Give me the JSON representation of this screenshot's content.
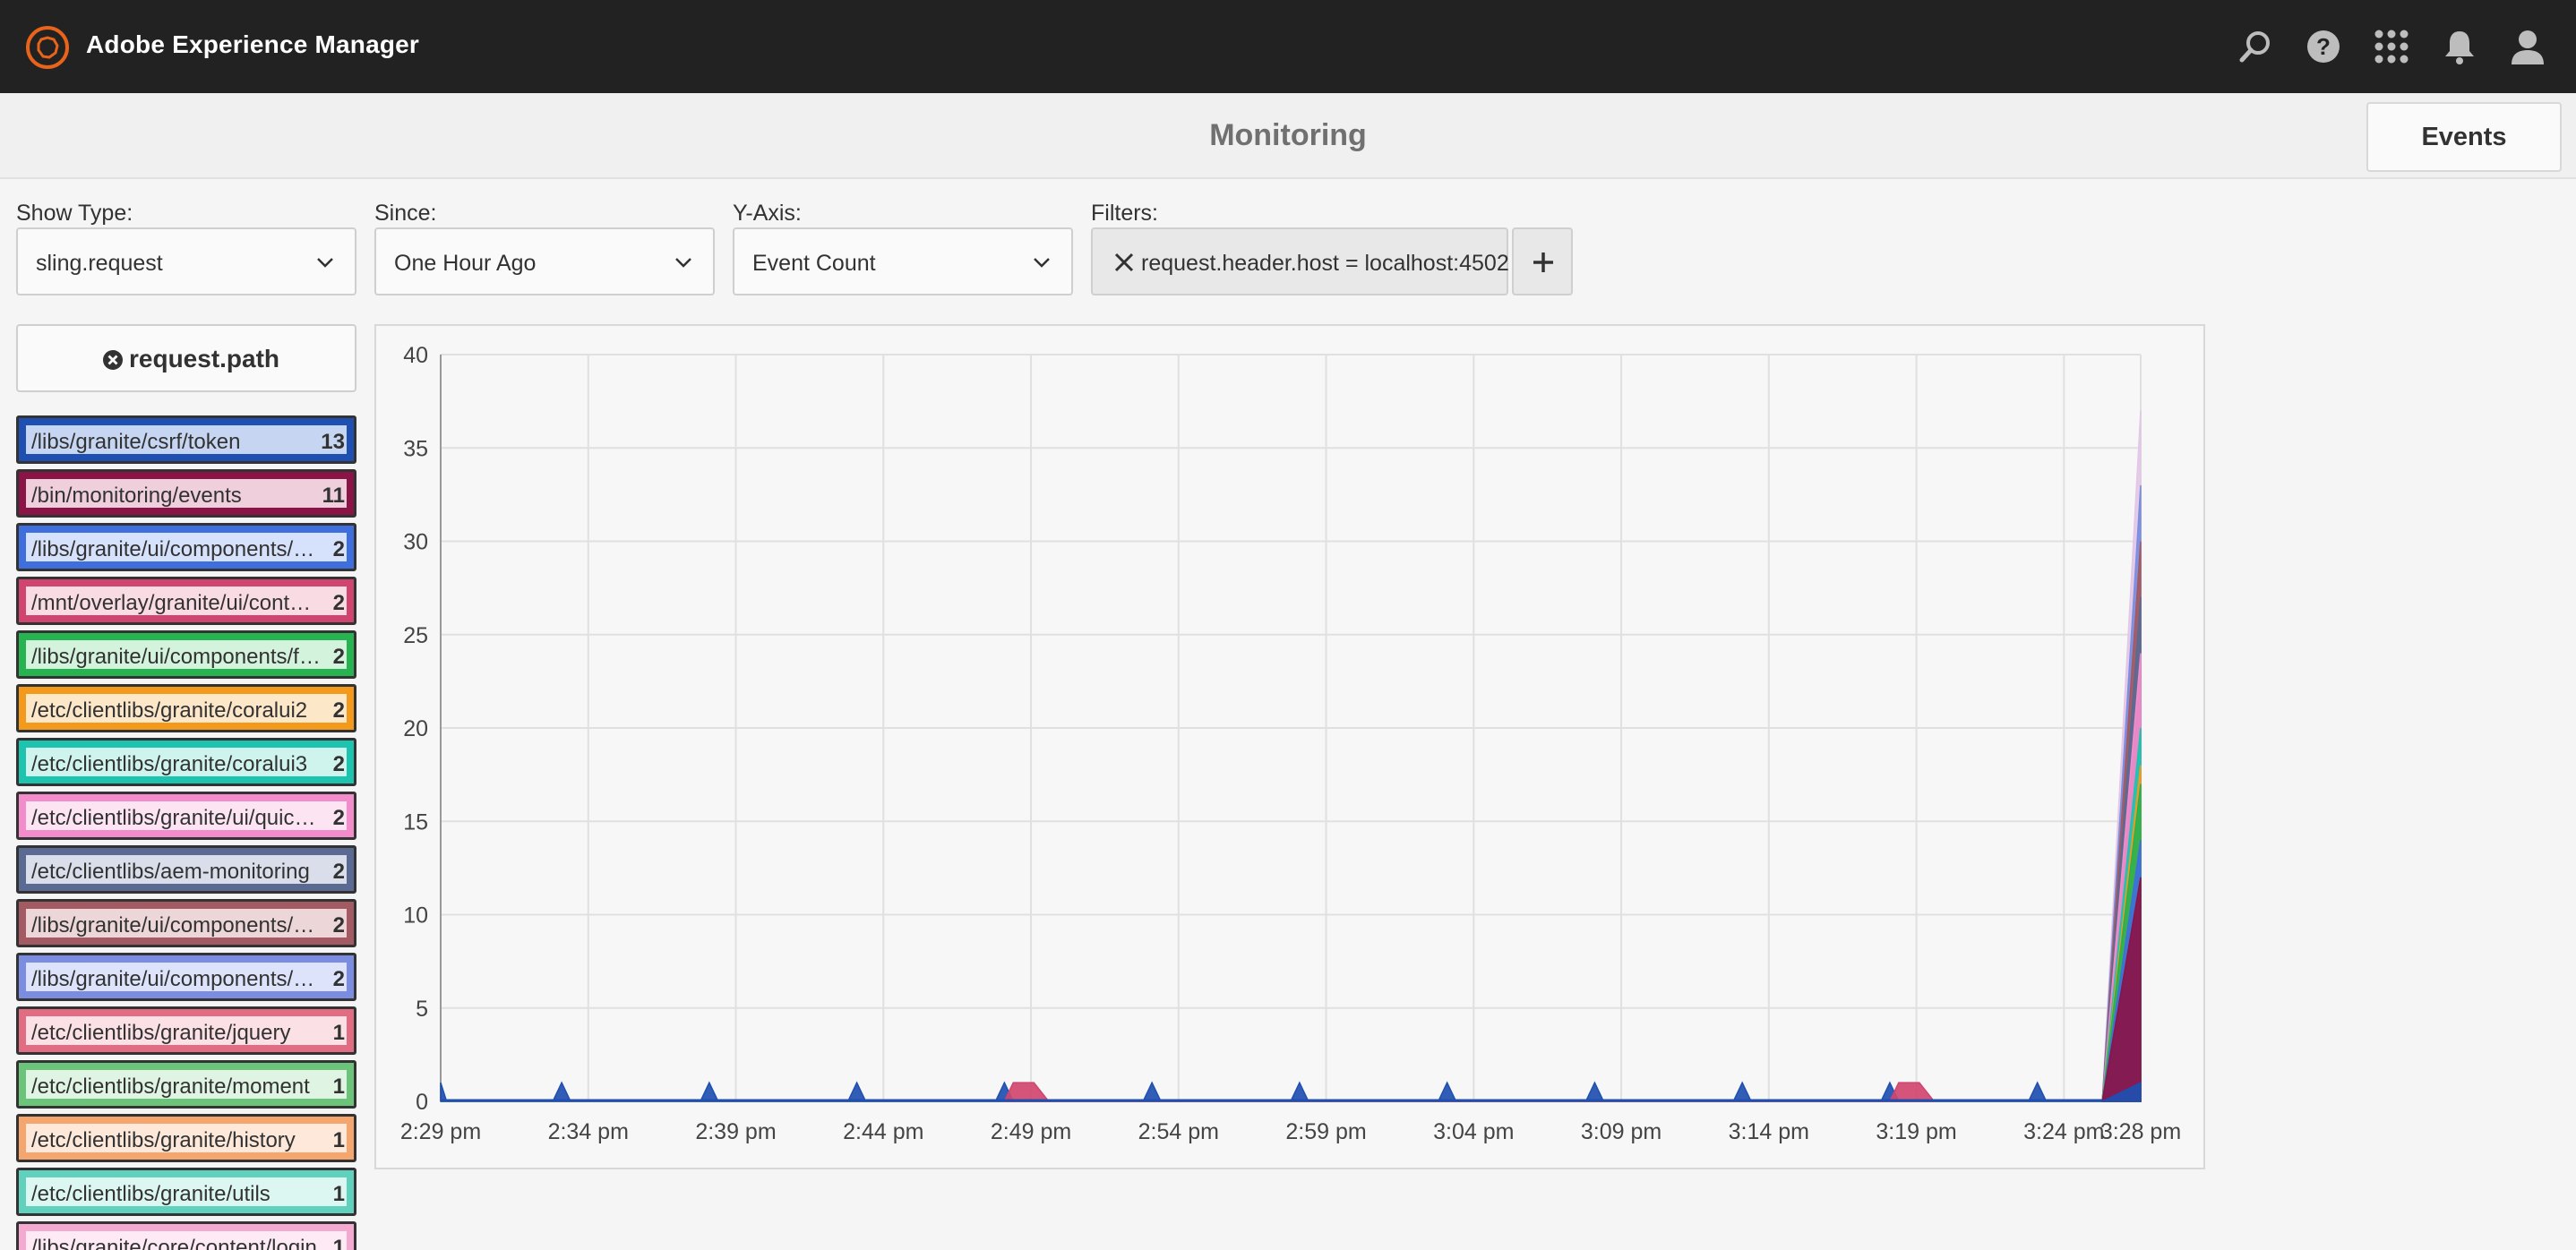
{
  "header": {
    "app_title": "Adobe Experience Manager",
    "icons": [
      "search-icon",
      "help-icon",
      "solutions-icon",
      "notifications-icon",
      "user-icon"
    ]
  },
  "subheader": {
    "title": "Monitoring",
    "events_label": "Events"
  },
  "controls": {
    "show_type": {
      "label": "Show Type:",
      "value": "sling.request"
    },
    "since": {
      "label": "Since:",
      "value": "One Hour Ago"
    },
    "y_axis": {
      "label": "Y-Axis:",
      "value": "Event Count"
    },
    "filters": {
      "label": "Filters:",
      "value": "request.header.host = localhost:4502"
    }
  },
  "group_by": {
    "label": "request.path"
  },
  "legend": [
    {
      "path": "/libs/granite/csrf/token",
      "count": "13",
      "border": "#1f4fb0",
      "fill": "#c6d6f2"
    },
    {
      "path": "/bin/monitoring/events",
      "count": "11",
      "border": "#8a1446",
      "fill": "#efcfdc"
    },
    {
      "path": "/libs/granite/ui/components/coral/foundation",
      "count": "2",
      "border": "#3f6fdc",
      "fill": "#d6e2fb"
    },
    {
      "path": "/mnt/overlay/granite/ui/content/shell",
      "count": "2",
      "border": "#d0456f",
      "fill": "#f9dbe4"
    },
    {
      "path": "/libs/granite/ui/components/foundation",
      "count": "2",
      "border": "#27b34f",
      "fill": "#d3f3dc"
    },
    {
      "path": "/etc/clientlibs/granite/coralui2",
      "count": "2",
      "border": "#f39a1d",
      "fill": "#fde7c9"
    },
    {
      "path": "/etc/clientlibs/granite/coralui3",
      "count": "2",
      "border": "#1cc4b0",
      "fill": "#cff4ee"
    },
    {
      "path": "/etc/clientlibs/granite/ui/quickstart",
      "count": "2",
      "border": "#f28ccb",
      "fill": "#fde4f2"
    },
    {
      "path": "/etc/clientlibs/aem-monitoring",
      "count": "2",
      "border": "#5a6a92",
      "fill": "#d9deea"
    },
    {
      "path": "/libs/granite/ui/components/shell",
      "count": "2",
      "border": "#a45a62",
      "fill": "#ecd6d8"
    },
    {
      "path": "/libs/granite/ui/components/shell/header",
      "count": "2",
      "border": "#7a8de0",
      "fill": "#dde3fa"
    },
    {
      "path": "/etc/clientlibs/granite/jquery",
      "count": "1",
      "border": "#e26d83",
      "fill": "#fbe0e6"
    },
    {
      "path": "/etc/clientlibs/granite/moment",
      "count": "1",
      "border": "#6cc47a",
      "fill": "#e0f4e3"
    },
    {
      "path": "/etc/clientlibs/granite/history",
      "count": "1",
      "border": "#f5a56e",
      "fill": "#fde8da"
    },
    {
      "path": "/etc/clientlibs/granite/utils",
      "count": "1",
      "border": "#5fd1bd",
      "fill": "#dcf6f1"
    },
    {
      "path": "/libs/granite/core/content/login",
      "count": "1",
      "border": "#f3a9d0",
      "fill": "#fdeaf4"
    }
  ],
  "chart_data": {
    "type": "area",
    "x_ticks": [
      "2:29 pm",
      "2:34 pm",
      "2:39 pm",
      "2:44 pm",
      "2:49 pm",
      "2:54 pm",
      "2:59 pm",
      "3:04 pm",
      "3:09 pm",
      "3:14 pm",
      "3:19 pm",
      "3:24 pm",
      "3:28 pm"
    ],
    "ylim": [
      0,
      40
    ],
    "y_ticks": [
      0,
      5,
      10,
      15,
      20,
      25,
      30,
      35,
      40
    ],
    "grid": true,
    "series": [
      {
        "color": "#1f4fb0",
        "points": [
          [
            0,
            1
          ],
          [
            0.2,
            0
          ],
          [
            3.8,
            0
          ],
          [
            4.1,
            1
          ],
          [
            4.4,
            0
          ],
          [
            8.8,
            0
          ],
          [
            9.1,
            1
          ],
          [
            9.4,
            0
          ],
          [
            13.8,
            0
          ],
          [
            14.1,
            1
          ],
          [
            14.4,
            0
          ],
          [
            18.8,
            0
          ],
          [
            19.1,
            1
          ],
          [
            19.4,
            0
          ],
          [
            23.8,
            0
          ],
          [
            24.1,
            1
          ],
          [
            24.4,
            0
          ],
          [
            28.8,
            0
          ],
          [
            29.1,
            1
          ],
          [
            29.4,
            0
          ],
          [
            33.8,
            0
          ],
          [
            34.1,
            1
          ],
          [
            34.4,
            0
          ],
          [
            38.8,
            0
          ],
          [
            39.1,
            1
          ],
          [
            39.4,
            0
          ],
          [
            43.8,
            0
          ],
          [
            44.1,
            1
          ],
          [
            44.4,
            0
          ],
          [
            48.8,
            0
          ],
          [
            49.1,
            1
          ],
          [
            49.4,
            0
          ],
          [
            53.8,
            0
          ],
          [
            54.1,
            1
          ],
          [
            54.4,
            0
          ],
          [
            56.3,
            0
          ],
          [
            57.6,
            1
          ]
        ]
      },
      {
        "color": "#d0456f",
        "points": [
          [
            19.1,
            0
          ],
          [
            19.4,
            1
          ],
          [
            20.1,
            1
          ],
          [
            20.6,
            0
          ],
          [
            49.1,
            0
          ],
          [
            49.4,
            1
          ],
          [
            50.1,
            1
          ],
          [
            50.6,
            0
          ]
        ]
      },
      {
        "color": "#8a1446",
        "points": [
          [
            56.3,
            0
          ],
          [
            57.6,
            12
          ]
        ]
      },
      {
        "color": "#3f6fdc",
        "points": [
          [
            56.3,
            0
          ],
          [
            57.6,
            14
          ]
        ]
      },
      {
        "color": "#1cc4b0",
        "points": [
          [
            56.3,
            0
          ],
          [
            57.6,
            20
          ]
        ]
      },
      {
        "color": "#27b34f",
        "points": [
          [
            56.3,
            0
          ],
          [
            57.6,
            17
          ]
        ]
      },
      {
        "color": "#f39a1d",
        "points": [
          [
            56.3,
            0
          ],
          [
            57.6,
            18
          ]
        ]
      },
      {
        "color": "#f28ccb",
        "points": [
          [
            56.3,
            0
          ],
          [
            57.6,
            24
          ]
        ]
      },
      {
        "color": "#5a6a92",
        "points": [
          [
            56.3,
            0
          ],
          [
            57.6,
            27
          ]
        ]
      },
      {
        "color": "#a45a62",
        "points": [
          [
            56.3,
            0
          ],
          [
            57.6,
            30
          ]
        ]
      },
      {
        "color": "#7a8de0",
        "points": [
          [
            56.3,
            0
          ],
          [
            57.6,
            33
          ]
        ]
      },
      {
        "color": "#e2c7e6",
        "points": [
          [
            56.3,
            0
          ],
          [
            57.6,
            37
          ]
        ]
      }
    ]
  }
}
